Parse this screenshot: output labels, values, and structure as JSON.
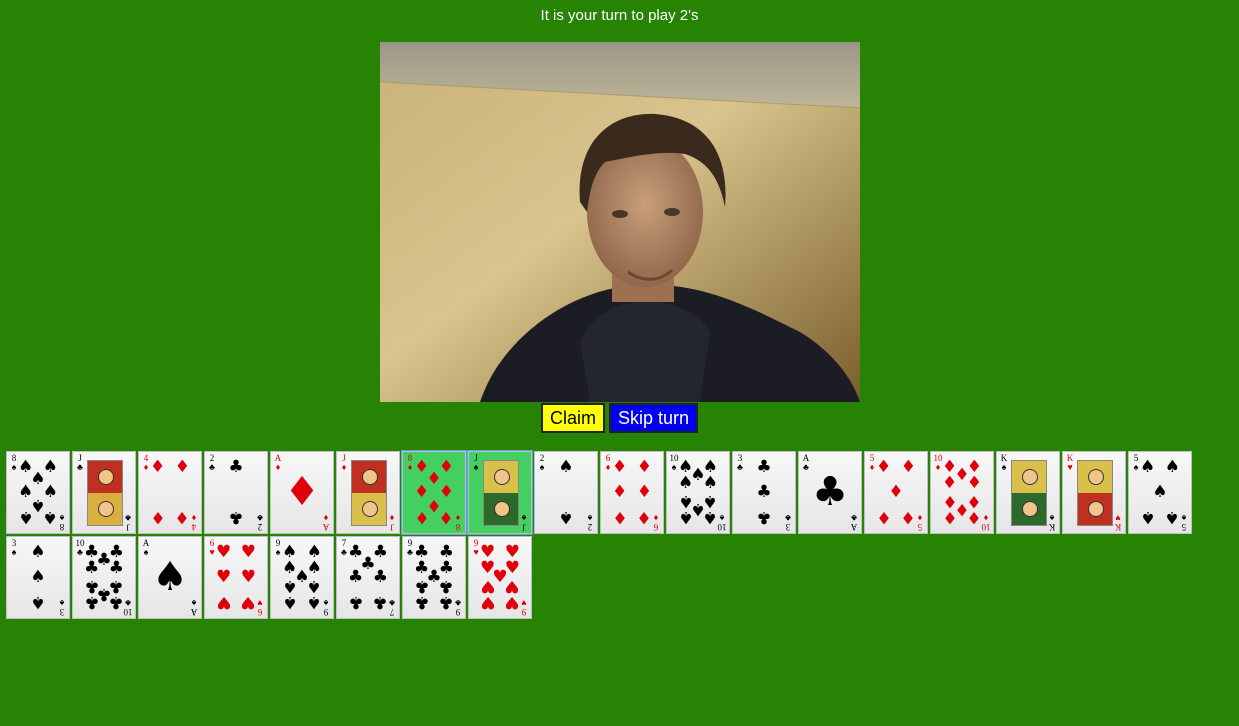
{
  "status": {
    "message": "It is your turn to play 2's"
  },
  "video": {
    "description_icon": "webcam-video-feed"
  },
  "actions": {
    "claim_label": "Claim",
    "skip_label": "Skip turn"
  },
  "colors": {
    "table_green": "#268303",
    "claim_yellow": "#ffff00",
    "skip_blue": "#0000ee",
    "selected_green": "#44d060",
    "red_suit": "#e0000c"
  },
  "hand": [
    {
      "rank": "8",
      "suit": "spades",
      "selected": false
    },
    {
      "rank": "J",
      "suit": "clubs",
      "selected": false
    },
    {
      "rank": "4",
      "suit": "diamonds",
      "selected": false
    },
    {
      "rank": "2",
      "suit": "clubs",
      "selected": false
    },
    {
      "rank": "A",
      "suit": "diamonds",
      "selected": false
    },
    {
      "rank": "J",
      "suit": "diamonds",
      "selected": false
    },
    {
      "rank": "8",
      "suit": "diamonds",
      "selected": true
    },
    {
      "rank": "J",
      "suit": "spades",
      "selected": true
    },
    {
      "rank": "2",
      "suit": "spades",
      "selected": false
    },
    {
      "rank": "6",
      "suit": "diamonds",
      "selected": false
    },
    {
      "rank": "10",
      "suit": "spades",
      "selected": false
    },
    {
      "rank": "3",
      "suit": "clubs",
      "selected": false
    },
    {
      "rank": "A",
      "suit": "clubs",
      "selected": false
    },
    {
      "rank": "5",
      "suit": "diamonds",
      "selected": false
    },
    {
      "rank": "10",
      "suit": "diamonds",
      "selected": false
    },
    {
      "rank": "K",
      "suit": "spades",
      "selected": false
    },
    {
      "rank": "K",
      "suit": "hearts",
      "selected": false
    },
    {
      "rank": "5",
      "suit": "spades",
      "selected": false
    },
    {
      "rank": "3",
      "suit": "spades",
      "selected": false
    },
    {
      "rank": "10",
      "suit": "clubs",
      "selected": false
    },
    {
      "rank": "A",
      "suit": "spades",
      "selected": false
    },
    {
      "rank": "6",
      "suit": "hearts",
      "selected": false
    },
    {
      "rank": "9",
      "suit": "spades",
      "selected": false
    },
    {
      "rank": "7",
      "suit": "clubs",
      "selected": false
    },
    {
      "rank": "9",
      "suit": "clubs",
      "selected": false
    },
    {
      "rank": "9",
      "suit": "hearts",
      "selected": false
    }
  ]
}
